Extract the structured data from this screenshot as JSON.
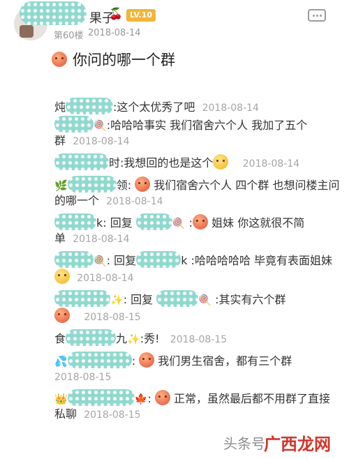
{
  "post": {
    "author_tail": "果子",
    "level": "LV.10",
    "floor": "第60楼",
    "date": "2018-08-14",
    "content": "你问的哪一个群"
  },
  "replies": [
    {
      "name_start": "炖",
      "name_end": "",
      "text": ":这个太优秀了吧",
      "time": "2018-08-14"
    },
    {
      "name_start": "",
      "name_end": "",
      "text": ":哈哈哈事实 我们宿舍六个人 我加了五个群",
      "time": "2018-08-14"
    },
    {
      "name_start": "",
      "name_end": "时",
      "text": ":我想回的也是这个",
      "time": "2018-08-14"
    },
    {
      "name_start": "",
      "name_end": "领",
      "text": "我们宿舍六个人 四个群 也想问楼主问的哪一个",
      "time": "2018-08-14"
    },
    {
      "name_start": "",
      "name_end": "k",
      "reply_to": "回复",
      "text": "姐妹 你这就很不简单",
      "time": "2018-08-14"
    },
    {
      "name_start": "",
      "name_end": "",
      "reply_to": "回复",
      "reply_to_end": "k",
      "text": ":哈哈哈哈哈 毕竟有表面姐妹",
      "time": "2018-08-14"
    },
    {
      "name_start": "",
      "name_end": "",
      "reply_to": "回复",
      "text": ":其实有六个群",
      "time": "2018-08-15"
    },
    {
      "name_start": "食",
      "name_end": "九",
      "text": ":秀!",
      "time": "2018-08-15"
    },
    {
      "name_start": "",
      "name_end": "",
      "text": "我们男生宿舍，都有三个群",
      "time": "2018-08-15"
    },
    {
      "name_start": "",
      "name_end": "",
      "text": "正常，虽然最后都不用群了直接私聊",
      "time": "2018-08-15"
    }
  ],
  "watermark": {
    "text": "头条号",
    "brand": "广西龙网"
  }
}
